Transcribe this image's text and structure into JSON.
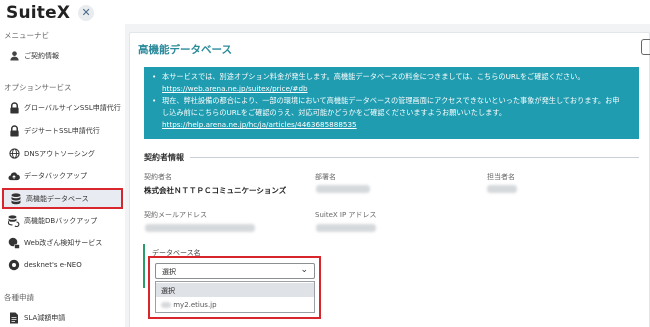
{
  "app": {
    "title": "SuiteX"
  },
  "sidebar": {
    "sections": [
      {
        "label": "メニューナビ"
      },
      {
        "label": "オプションサービス"
      },
      {
        "label": "各種申請"
      }
    ],
    "items": [
      {
        "label": "ご契約情報",
        "icon": "user-icon"
      },
      {
        "label": "グローバルサインSSL申請代行",
        "icon": "lock-icon"
      },
      {
        "label": "デジサートSSL申請代行",
        "icon": "lock-icon"
      },
      {
        "label": "DNSアウトソーシング",
        "icon": "globe-icon"
      },
      {
        "label": "データバックアップ",
        "icon": "cloud-upload-icon"
      },
      {
        "label": "高機能データベース",
        "icon": "database-icon"
      },
      {
        "label": "高機能DBバックアップ",
        "icon": "database-refresh-icon"
      },
      {
        "label": "Web改ざん検知サービス",
        "icon": "globe-lock-icon"
      },
      {
        "label": "desknet's e-NEO",
        "icon": "gear-icon"
      },
      {
        "label": "SLA減額申請",
        "icon": "document-icon"
      }
    ]
  },
  "main": {
    "title": "高機能データベース",
    "notice": {
      "line1": "本サービスでは、別途オプション料金が発生します。高機能データベースの料金につきましては、こちらのURLをご確認ください。",
      "link1": "https://web.arena.ne.jp/suitex/price/#db",
      "line2a": "現在、弊社設備の都合により、一部の環境において高機能データベースの管理画面にアクセスできないといった事象が発生しております。お申",
      "line2b": "し込み前にこちらのURLをご確認のうえ、対応可能かどうかをご確認くださいますようお願いいたします。",
      "link2": "https://help.arena.ne.jp/hc/ja/articles/4463685888535"
    },
    "contract": {
      "heading": "契約者情報",
      "name_label": "契約者名",
      "name_value": "株式会社ＮＴＴＰＣコミュニケーションズ",
      "dept_label": "部署名",
      "person_label": "担当者名",
      "email_label": "契約メールアドレス",
      "ip_label": "SuiteX IP アドレス"
    },
    "database": {
      "label": "データベース名",
      "select_value": "選択",
      "options": [
        "選択",
        "my2.etius.jp"
      ]
    }
  }
}
